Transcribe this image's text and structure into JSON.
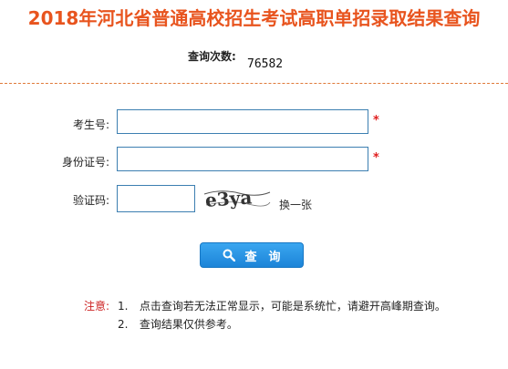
{
  "header": {
    "title": "2018年河北省普通高校招生考试高职单招录取结果查询",
    "title_color": "#e8541e"
  },
  "stats": {
    "count_label": "查询次数:",
    "count_value": "76582"
  },
  "divider_color": "#e07a3a",
  "form": {
    "exam_number_label": "考生号:",
    "exam_number_value": "",
    "id_number_label": "身份证号:",
    "id_number_value": "",
    "captcha_label": "验证码:",
    "captcha_value": "",
    "captcha_image_text": "e3ya",
    "refresh_label": "换一张",
    "required_mark": "*",
    "required_color": "#e02020"
  },
  "actions": {
    "query_label": "查　询"
  },
  "notes": {
    "label": "注意:",
    "label_color": "#cc2222",
    "items": [
      {
        "num": "1.",
        "text": "点击查询若无法正常显示，可能是系统忙，请避开高峰期查询。"
      },
      {
        "num": "2.",
        "text": "查询结果仅供参考。"
      }
    ]
  }
}
